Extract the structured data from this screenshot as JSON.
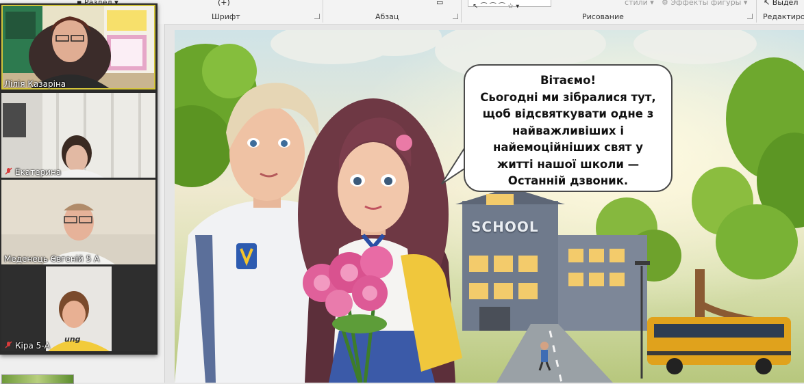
{
  "ribbon": {
    "section_label": "Раздел",
    "font_group": "Шрифт",
    "paragraph_group": "Абзац",
    "drawing_group": "Рисование",
    "editing_group": "Редактиро",
    "styles_label": "стили",
    "shape_effects_label": "Эффекты фигуры",
    "select_label": "Выдел"
  },
  "participants": [
    {
      "name": "Лілія Казаріна",
      "muted": false
    },
    {
      "name": "Екатерина",
      "muted": true
    },
    {
      "name": "Меденець Євгеній 5 А",
      "muted": false
    },
    {
      "name": "Кіра 5-А",
      "muted": true
    }
  ],
  "slide": {
    "school_sign": "SCHOOL",
    "bubble_lines": [
      "Вітаємо!",
      "Сьогодні ми зібралися тут,",
      "щоб відсвяткувати одне з",
      "найважливіших і",
      "найемоційніших свят у",
      "житті нашої школи —",
      "Останній дзвоник."
    ],
    "shirt_text": "ung"
  },
  "colors": {
    "active_speaker_outline": "#d3c53a",
    "muted_icon": "#d83b3b",
    "bus": "#e0a21c"
  }
}
